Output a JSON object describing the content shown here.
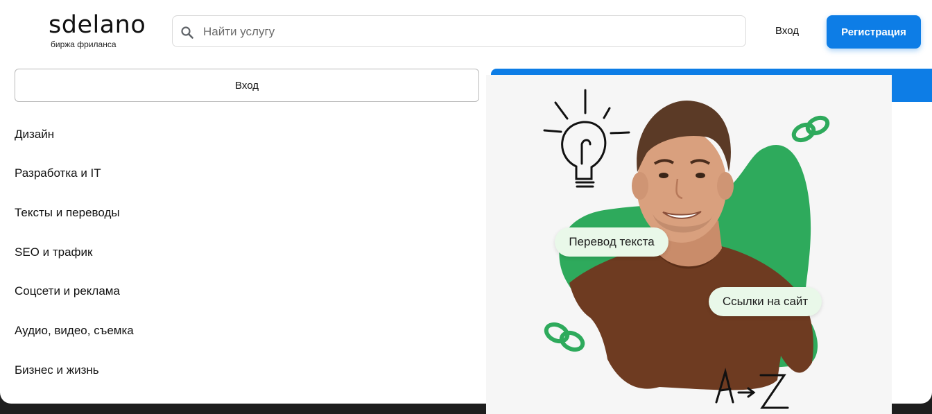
{
  "header": {
    "logo_text": "sdelano",
    "logo_subtitle": "биржа фриланса",
    "search_placeholder": "Найти услугу",
    "login_label": "Вход",
    "register_label": "Регистрация"
  },
  "menu": {
    "login_label": "Вход",
    "categories": [
      "Дизайн",
      "Разработка и IT",
      "Тексты и переводы",
      "SEO и трафик",
      "Соцсети и реклама",
      "Аудио, видео, съемка",
      "Бизнес и жизнь"
    ]
  },
  "promo": {
    "tags": [
      "Перевод текста",
      "Ссылки на сайт"
    ],
    "doodle_text": "A→Z"
  },
  "colors": {
    "accent_blue": "#0d7de6",
    "promo_green": "#2eaa5c",
    "tag_bg": "#e9f8e9"
  }
}
